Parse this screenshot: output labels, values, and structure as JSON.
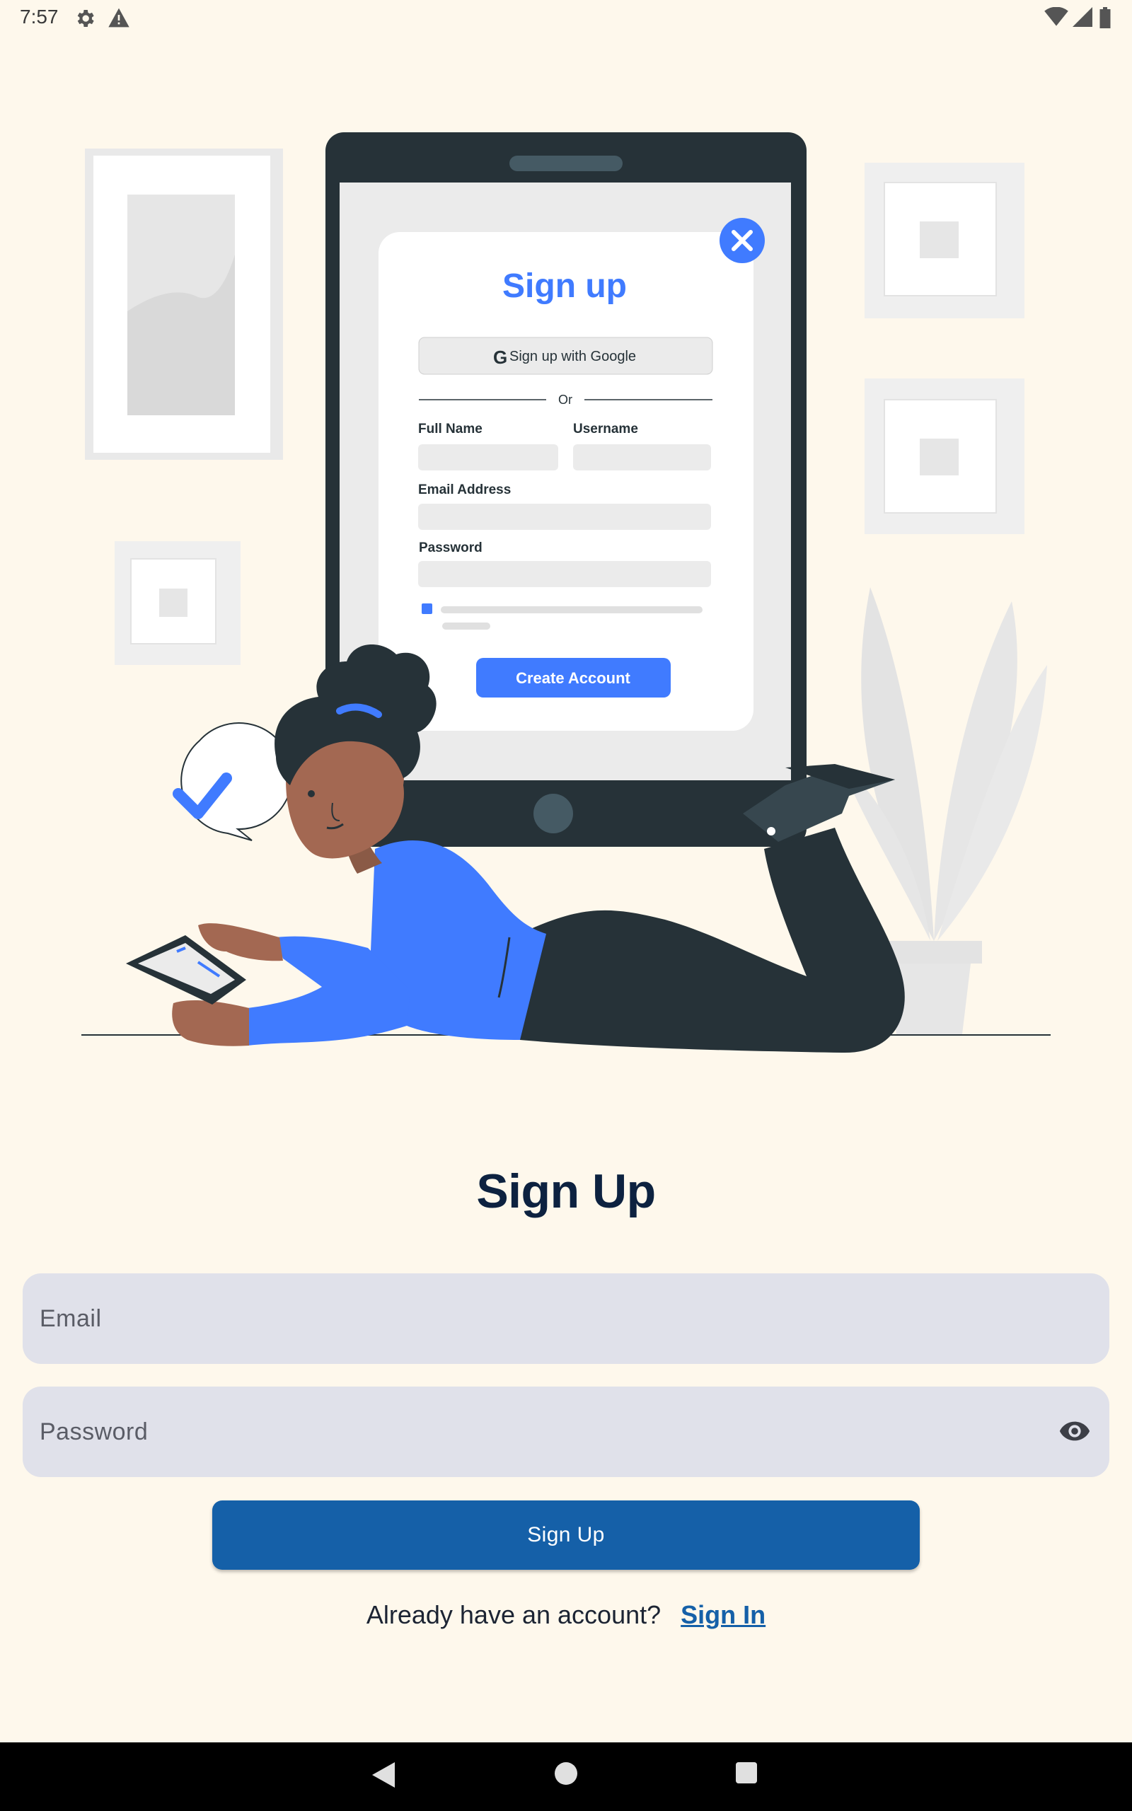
{
  "status_bar": {
    "time": "7:57",
    "icons": [
      "gear-icon",
      "warning-icon",
      "wifi-icon",
      "signal-icon",
      "battery-icon"
    ]
  },
  "illustration": {
    "modal_title": "Sign up",
    "google_button": "Sign up with Google",
    "divider_text": "Or",
    "full_name_label": "Full Name",
    "username_label": "Username",
    "email_label": "Email Address",
    "password_label": "Password",
    "create_button": "Create Account",
    "accent_color": "#407bff"
  },
  "form": {
    "title": "Sign Up",
    "email_placeholder": "Email",
    "password_placeholder": "Password",
    "submit_label": "Sign Up",
    "prompt": "Already have an account?",
    "signin_link": "Sign In"
  },
  "colors": {
    "background": "#fef8ec",
    "field_bg": "#e0e1ea",
    "primary": "#1560a8",
    "heading": "#0d2240"
  },
  "nav_bar": {
    "icons": [
      "back-icon",
      "home-icon",
      "recents-icon"
    ]
  }
}
